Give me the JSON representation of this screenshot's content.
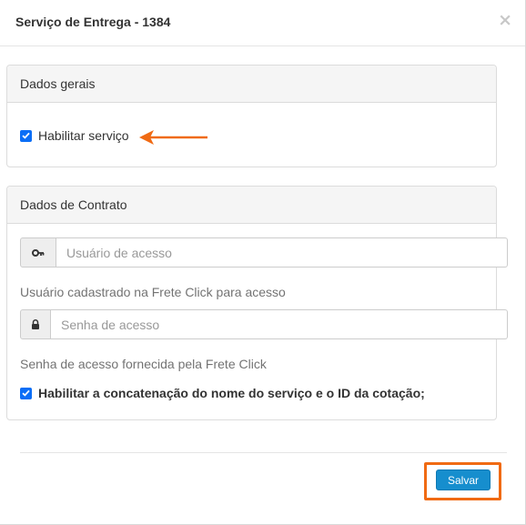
{
  "modal": {
    "title": "Serviço de Entrega - 1384",
    "close_symbol": "×"
  },
  "general": {
    "heading": "Dados gerais",
    "enable_service": {
      "label": "Habilitar serviço",
      "checked": true
    }
  },
  "contract": {
    "heading": "Dados de Contrato",
    "user_field": {
      "placeholder": "Usuário de acesso",
      "value": "",
      "icon": "key-icon"
    },
    "user_help": "Usuário cadastrado na Frete Click para acesso",
    "password_field": {
      "placeholder": "Senha de acesso",
      "value": "",
      "icon": "lock-icon"
    },
    "password_help": "Senha de acesso fornecida pela Frete Click",
    "concat_option": {
      "label": "Habilitar a concatenação do nome do serviço e o ID da cotação;",
      "checked": true
    }
  },
  "footer": {
    "save_label": "Salvar"
  },
  "colors": {
    "checkbox": "#0b6ef6",
    "annotation": "#f06a13",
    "save_button": "#168ece"
  }
}
